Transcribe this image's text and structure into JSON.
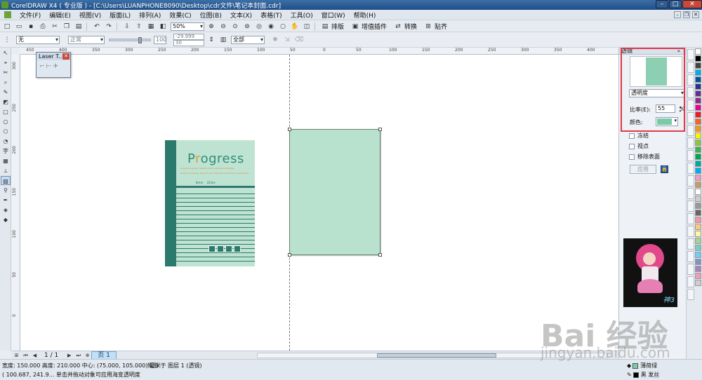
{
  "window": {
    "title": "CorelDRAW X4 ( 专业版 ) - [C:\\Users\\LUANPHONE8090\\Desktop\\cdr文件\\笔记本封面.cdr]"
  },
  "menubar": {
    "items": [
      "文件(F)",
      "编辑(E)",
      "视图(V)",
      "版面(L)",
      "排列(A)",
      "效果(C)",
      "位图(B)",
      "文本(X)",
      "表格(T)",
      "工具(O)",
      "窗口(W)",
      "帮助(H)"
    ]
  },
  "standard_toolbar": {
    "zoom": "50%",
    "layout_label": "排版",
    "plugin_label": "增值插件",
    "convert_label": "转换",
    "paste_label": "贴齐"
  },
  "property_bar": {
    "transparency_type": "无",
    "merge_mode": "正常",
    "slider_value": "100",
    "coord_x": "-29.999",
    "coord_y": "30",
    "target": "全部"
  },
  "laser_window": {
    "title": "Laser T..."
  },
  "ruler": {
    "h_ticks": [
      "450",
      "400",
      "350",
      "300",
      "250",
      "200",
      "150",
      "100",
      "50",
      "0",
      "50",
      "100",
      "150",
      "200",
      "250",
      "300",
      "350",
      "400",
      "450"
    ],
    "v_ticks": [
      "300",
      "250",
      "200",
      "150",
      "100",
      "50",
      "0"
    ],
    "unit": "毫米"
  },
  "notebook": {
    "title_before": "P",
    "title_accent": "r",
    "title_after": "ogress",
    "subtitle": "pursue progress, cherish youth, explore knowledge",
    "subtitle2": "persist in striving, become your best self and achieve excellence",
    "info_size": "8mm",
    "info_lines": "22line"
  },
  "pager": {
    "count": "1 / 1",
    "tab": "页 1"
  },
  "status": {
    "line1": "宽度: 150.000  高度: 210.000  中心: (75.000, 105.000)  毫米",
    "line2": "( 100.687, 241.9...   单击并拖动对象可应用海变透明度",
    "object_info": "矩形 于 图层 1 (透镜)",
    "fill_name": "薄荷绿",
    "outline_name": "黑 发丝",
    "fill_color": "#7dcaa8",
    "outline_color": "#000000"
  },
  "docker": {
    "title": "透镜",
    "lens_type": "透明度",
    "ratio_label": "比率(E):",
    "ratio_value": "55",
    "ratio_unit": "%",
    "color_label": "颜色:",
    "freeze_label": "冻结",
    "viewpoint_label": "视点",
    "remove_face_label": "移除表面",
    "apply_label": "应用",
    "lens_color": "#79caa7",
    "ad_logo": "神3"
  },
  "watermark": {
    "line1": "Bai 经验",
    "line2": "jingyan.baidu.com"
  }
}
